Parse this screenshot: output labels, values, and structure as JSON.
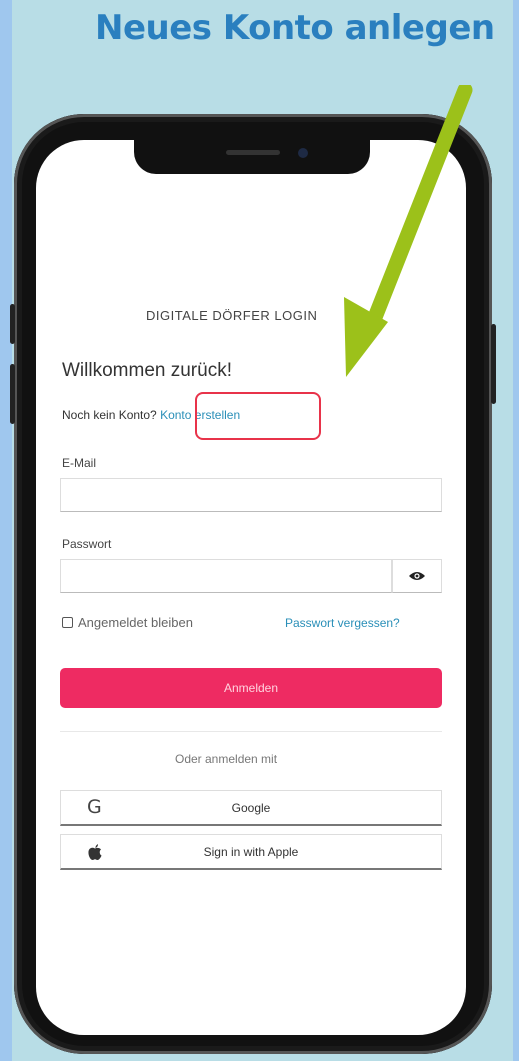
{
  "headline": "Neues Konto anlegen",
  "login": {
    "title": "DIGITALE DÖRFER LOGIN",
    "welcome": "Willkommen zurück!",
    "no_account": "Noch kein Konto?",
    "create_account": "Konto erstellen",
    "email_label": "E-Mail",
    "email_value": "",
    "password_label": "Passwort",
    "password_value": "",
    "remember_label": "Angemeldet bleiben",
    "forgot_label": "Passwort vergessen?",
    "submit_label": "Anmelden",
    "or_label": "Oder anmelden mit",
    "google_label": "Google",
    "apple_label": "Sign in with Apple"
  },
  "icons": {
    "arrow": "arrow-icon",
    "eye": "eye-icon",
    "google": "google-icon",
    "apple": "apple-icon"
  },
  "colors": {
    "accent_pink": "#ee2b62",
    "link_blue": "#2a8fb8",
    "arrow_green": "#9cc11a",
    "highlight_red": "#e8334a"
  }
}
